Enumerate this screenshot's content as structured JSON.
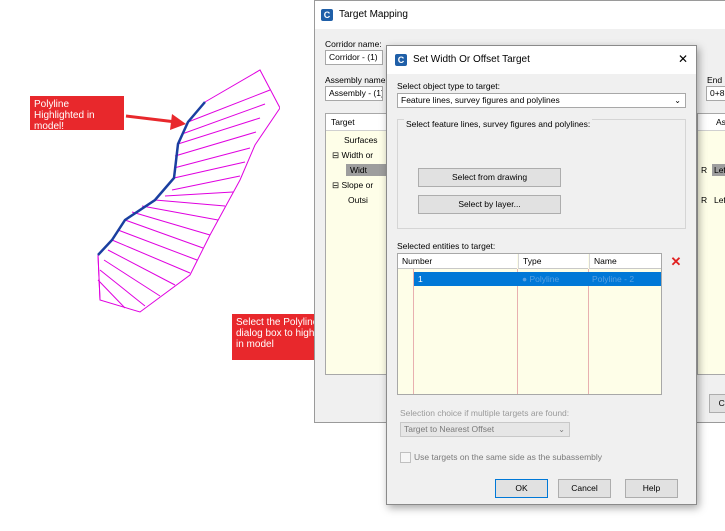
{
  "target_mapping": {
    "title": "Target Mapping",
    "icon_letter": "C",
    "corridor_name_label": "Corridor name:",
    "corridor_name_value": "Corridor - (1)",
    "assembly_name_label": "Assembly name:",
    "assembly_name_value": "Assembly - (1)",
    "end_label": "End S",
    "end_value": "0+8",
    "tree_header": "Target",
    "right_header": "As",
    "tree_items": [
      "Surfaces",
      "Width or",
      "Widt",
      "Slope or",
      "Outsi"
    ],
    "side_cells": [
      "R",
      "Lef",
      "R",
      "Lef"
    ],
    "cancel_button": "Ca"
  },
  "dialog": {
    "title": "Set Width Or Offset Target",
    "icon_letter": "C",
    "close_symbol": "✕",
    "select_type_label": "Select object type to target:",
    "select_type_value": "Feature lines, survey figures and polylines",
    "group_label": "Select feature lines, survey figures and polylines:",
    "select_from_drawing": "Select from drawing",
    "select_by_layer": "Select by layer...",
    "selected_entities_label": "Selected entities to target:",
    "table_headers": [
      "Number",
      "Type",
      "Name"
    ],
    "table_rows": [
      {
        "number": "1",
        "type": "Polyline",
        "name": "Polyline - 2"
      }
    ],
    "delete_symbol": "✕",
    "selection_choice_label": "Selection choice if multiple targets are found:",
    "selection_choice_value": "Target to Nearest Offset",
    "same_side_label": "Use targets on the same side as the subassembly",
    "ok_button": "OK",
    "cancel_button": "Cancel",
    "help_button": "Help"
  },
  "annotations": {
    "polyline_callout": "Polyline Highlighted in model!",
    "select_callout": "Select the Polyline in the dialog box to highlight it in model"
  },
  "colors": {
    "callout_red": "#e8282c",
    "polyline_blue": "#1a3fa0",
    "hatch_magenta": "#e000e0",
    "selection_blue": "#0078d7"
  }
}
